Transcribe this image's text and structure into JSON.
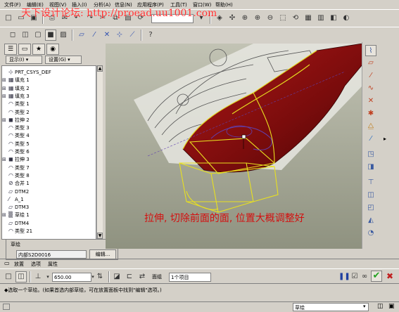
{
  "menubar": {
    "items": [
      "文件(F)",
      "编辑(E)",
      "视图(V)",
      "插入(I)",
      "分析(A)",
      "信息(N)",
      "应用程序(P)",
      "工具(T)",
      "窗口(W)",
      "帮助(H)"
    ]
  },
  "watermark": "天下设计论坛: http://proead.uu1001.com",
  "nav_tabs": [
    "model-tree",
    "folder",
    "favorites",
    "web"
  ],
  "tree_controls": {
    "show_label": "显示(I) ▾",
    "settings_label": "设置(G) ▾"
  },
  "tree": {
    "items": [
      {
        "label": "PRT_CSYS_DEF",
        "icon": "csys-icon",
        "expand": ""
      },
      {
        "label": "填充 1",
        "icon": "fill-icon",
        "expand": "+"
      },
      {
        "label": "填充 2",
        "icon": "fill-icon",
        "expand": "+"
      },
      {
        "label": "填充 3",
        "icon": "fill-icon",
        "expand": "+"
      },
      {
        "label": "类型 1",
        "icon": "surface-icon",
        "expand": ""
      },
      {
        "label": "类型 2",
        "icon": "surface-icon",
        "expand": ""
      },
      {
        "label": "拉伸 2",
        "icon": "extrude-icon",
        "expand": "+"
      },
      {
        "label": "类型 3",
        "icon": "surface-icon",
        "expand": ""
      },
      {
        "label": "类型 4",
        "icon": "surface-icon",
        "expand": ""
      },
      {
        "label": "类型 5",
        "icon": "surface-icon",
        "expand": ""
      },
      {
        "label": "类型 6",
        "icon": "surface-icon",
        "expand": ""
      },
      {
        "label": "拉伸 3",
        "icon": "extrude-icon",
        "expand": "+"
      },
      {
        "label": "类型 7",
        "icon": "surface-icon",
        "expand": ""
      },
      {
        "label": "类型 8",
        "icon": "surface-icon",
        "expand": ""
      },
      {
        "label": "合并 1",
        "icon": "merge-icon",
        "expand": ""
      },
      {
        "label": "DTM2",
        "icon": "datum-plane-icon",
        "expand": ""
      },
      {
        "label": "A_1",
        "icon": "axis-icon",
        "expand": ""
      },
      {
        "label": "DTM3",
        "icon": "datum-plane-icon",
        "expand": ""
      },
      {
        "label": "草绘 1",
        "icon": "sketch-icon",
        "expand": "+"
      },
      {
        "label": "DTM4",
        "icon": "datum-plane-icon",
        "expand": ""
      },
      {
        "label": "类型 21",
        "icon": "surface-icon",
        "expand": ""
      }
    ]
  },
  "sketch_panel": {
    "title": "草绘",
    "value": "内部S2D0016",
    "edit_button": "编辑..."
  },
  "dashboard_tabs": [
    "放置",
    "选项",
    "属性"
  ],
  "dashboard": {
    "depth_value": "650.00",
    "face_group_label": "面组",
    "face_group_value": "1个项目"
  },
  "message": {
    "line1": "◆选取一个草绘。(如果首选内部草绘，可在放置面板中找到\"编辑\"选项。)"
  },
  "status": {
    "filter_value": "草绘"
  },
  "annotation": "拉伸, 切除前面的面, 位置大概调整好",
  "colors": {
    "body_red": "#8a1010",
    "highlight_yellow": "#e8e020",
    "annotation_red": "#d41010",
    "viewport_bg": "#a9ab96"
  }
}
